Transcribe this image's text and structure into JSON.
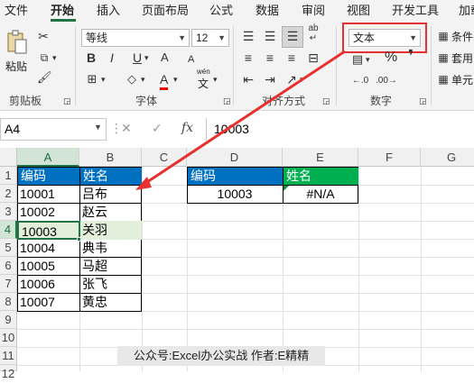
{
  "menu": [
    "文件",
    "开始",
    "插入",
    "页面布局",
    "公式",
    "数据",
    "审阅",
    "视图",
    "开发工具",
    "加载"
  ],
  "ribbon": {
    "clipboard": {
      "paste_label": "粘贴",
      "group_label": "剪贴板"
    },
    "font": {
      "font_name": "等线",
      "font_size": "12",
      "bold": "B",
      "italic": "I",
      "underline": "U",
      "font_color_letter": "A",
      "grow_font": "A",
      "shrink_font": "A",
      "wen_label": "wén",
      "wen_char": "文",
      "group_label": "字体"
    },
    "alignment": {
      "wrap_label": "ab",
      "group_label": "对齐方式"
    },
    "number": {
      "format_value": "文本",
      "percent": "%",
      "comma": "❜",
      "group_label": "数字"
    },
    "styles": {
      "conditional": "条件",
      "table": "套用",
      "cell": "单元"
    }
  },
  "formula_bar": {
    "name_box": "A4",
    "fx": "fx",
    "cancel": "✕",
    "confirm": "✓",
    "value": "10003"
  },
  "columns": [
    "A",
    "B",
    "C",
    "D",
    "E",
    "F",
    "G"
  ],
  "rows": [
    "1",
    "2",
    "3",
    "4",
    "5",
    "6",
    "7",
    "8",
    "9",
    "10",
    "11",
    "12"
  ],
  "table1": {
    "headers": [
      "编码",
      "姓名"
    ],
    "rows": [
      [
        "10001",
        "吕布"
      ],
      [
        "10002",
        "赵云"
      ],
      [
        "10003",
        "关羽"
      ],
      [
        "10004",
        "典韦"
      ],
      [
        "10005",
        "马超"
      ],
      [
        "10006",
        "张飞"
      ],
      [
        "10007",
        "黄忠"
      ]
    ]
  },
  "table2": {
    "headers": [
      "编码",
      "姓名"
    ],
    "row": [
      "10003",
      "#N/A"
    ]
  },
  "watermark": "公众号:Excel办公实战  作者:E精精",
  "colors": {
    "accent_green": "#217346",
    "header_blue": "#0070c0",
    "header_green": "#00b050",
    "selection_fill": "#e2efda",
    "annotation_red": "#e8312f"
  }
}
